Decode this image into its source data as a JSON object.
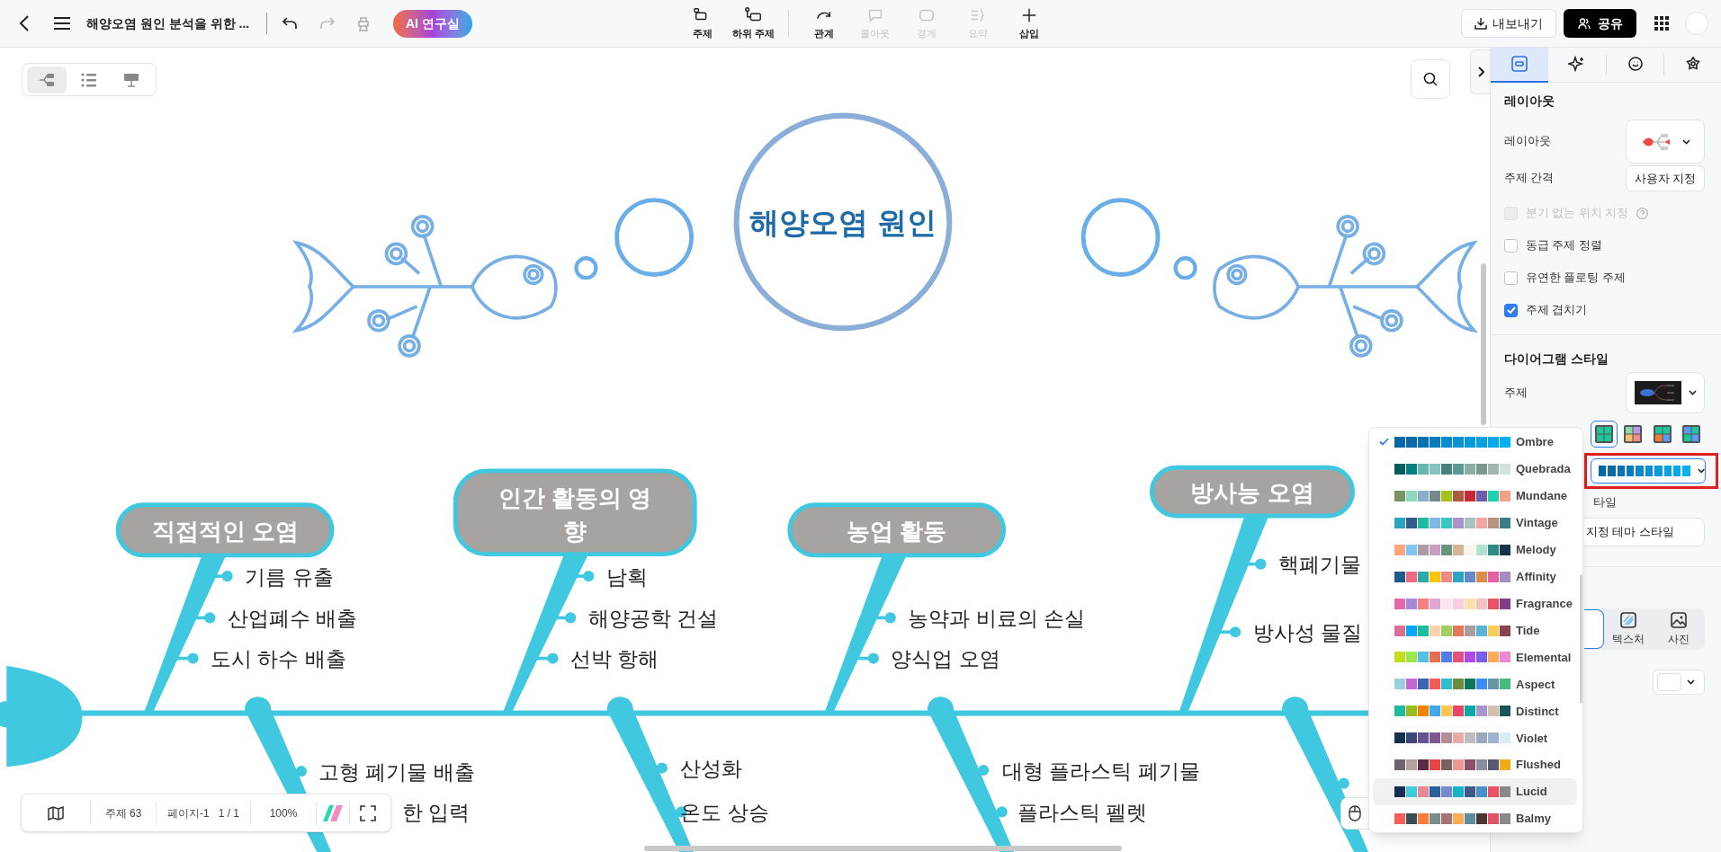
{
  "toolbar": {
    "title": "해양오염 원인 분석을 위한 ...",
    "ai_button": "AI 연구실",
    "tools": [
      {
        "label": "주제",
        "kind": "topic",
        "disabled": false
      },
      {
        "label": "하위 주제",
        "kind": "subtopic",
        "disabled": false
      },
      {
        "label": "관계",
        "kind": "relation",
        "disabled": false
      },
      {
        "label": "콜아웃",
        "kind": "callout",
        "disabled": true
      },
      {
        "label": "경계",
        "kind": "boundary",
        "disabled": true
      },
      {
        "label": "요약",
        "kind": "summary",
        "disabled": true
      },
      {
        "label": "삽입",
        "kind": "insert",
        "disabled": false
      }
    ],
    "export_button": "내보내기",
    "share_button": "공유"
  },
  "view_modes": [
    {
      "kind": "mindmap",
      "selected": true
    },
    {
      "kind": "outline",
      "selected": false
    },
    {
      "kind": "slides",
      "selected": false
    }
  ],
  "diagram": {
    "central_topic": "해양오염 원인",
    "categories": [
      {
        "label": "직접적인 오염",
        "causes": [
          "기름 유출",
          "산업폐수 배출",
          "도시 하수 배출"
        ]
      },
      {
        "label": "인간 활동의 영향",
        "causes": [
          "남획",
          "해양공학 건설",
          "선박 항해"
        ]
      },
      {
        "label": "농업 활동",
        "causes": [
          "농약과 비료의 손실",
          "양식업 오염"
        ]
      },
      {
        "label": "방사능 오염",
        "causes": [
          "핵폐기물",
          "방사성 물질"
        ]
      }
    ],
    "lower_branches": [
      {
        "kind": "branch",
        "causes": [
          "고형 폐기물 배출",
          "한 입력"
        ]
      },
      {
        "kind": "branch",
        "causes": [
          "산성화",
          "온도 상승"
        ]
      },
      {
        "kind": "branch",
        "causes": [
          "대형 플라스틱 폐기물",
          "플라스틱 펠렛"
        ]
      },
      {
        "kind": "stub"
      }
    ]
  },
  "status_bar": {
    "topics": "주제 63",
    "page": "페이지-1",
    "page_count": "1 / 1",
    "zoom": "100%"
  },
  "panel": {
    "tabs": [
      {
        "kind": "layout",
        "selected": true
      },
      {
        "kind": "ai",
        "selected": false
      },
      {
        "kind": "marker",
        "selected": false
      },
      {
        "kind": "style",
        "selected": false
      }
    ],
    "layout": {
      "title": "레이아웃",
      "layout_label": "레이아웃",
      "spacing_label": "주제 간격",
      "spacing_button": "사용자 지정",
      "options": [
        {
          "label": "분기 없는 위치 지정",
          "checked": false,
          "disabled": true,
          "help": true
        },
        {
          "label": "동급 주제 정렬",
          "checked": false,
          "disabled": false
        },
        {
          "label": "유연한 플로팅 주제",
          "checked": false,
          "disabled": false
        },
        {
          "label": "주제 겹치기",
          "checked": true,
          "disabled": false
        }
      ]
    },
    "diagram_style": {
      "title": "다이어그램 스타일",
      "theme_label": "주제",
      "color_schemes": [
        {
          "kind": "green",
          "selected": true
        },
        {
          "kind": "rainbow",
          "selected": false
        },
        {
          "kind": "orange",
          "selected": false
        },
        {
          "kind": "blue",
          "selected": false
        }
      ],
      "style_label": "타일",
      "custom_button": "지정 테마 스타일"
    },
    "background": {
      "segments": [
        {
          "kind": "color",
          "selected": true
        },
        {
          "kind": "texture",
          "label": "텍스처",
          "selected": false
        },
        {
          "kind": "photo",
          "label": "사진",
          "selected": false
        }
      ]
    }
  },
  "palette_menu": {
    "items": [
      {
        "label": "Ombre",
        "selected": true,
        "hovered": false,
        "swatches": [
          {
            "color": "#0568a6"
          },
          {
            "color": "#0a6aa8"
          },
          {
            "color": "#0b72b2"
          },
          {
            "color": "#0a7bbf"
          },
          {
            "color": "#088acf"
          },
          {
            "color": "#0793d6"
          },
          {
            "color": "#079bdc"
          },
          {
            "color": "#05a1e0"
          },
          {
            "color": "#04aae8"
          },
          {
            "color": "#03b0f0"
          }
        ]
      },
      {
        "label": "Quebrada",
        "selected": false,
        "hovered": false,
        "swatches": [
          {
            "color": "#005d5d"
          },
          {
            "color": "#008080"
          },
          {
            "color": "#6ab7b0"
          },
          {
            "color": "#88c3c3"
          },
          {
            "color": "#4a8078"
          },
          {
            "color": "#5a9a92"
          },
          {
            "color": "#8ab0a4"
          },
          {
            "color": "#7a9a8c"
          },
          {
            "color": "#a4b4ae"
          },
          {
            "color": "#d0e2dc"
          }
        ]
      },
      {
        "label": "Mundane",
        "selected": false,
        "hovered": false,
        "swatches": [
          {
            "color": "#7a9460"
          },
          {
            "color": "#8cdabb"
          },
          {
            "color": "#8ab0c8"
          },
          {
            "color": "#778890"
          },
          {
            "color": "#a4c41a"
          },
          {
            "color": "#b05a44"
          },
          {
            "color": "#c62a32"
          },
          {
            "color": "#6c5eac"
          },
          {
            "color": "#20d0a8"
          },
          {
            "color": "#f2a284"
          }
        ]
      },
      {
        "label": "Vintage",
        "selected": false,
        "hovered": false,
        "swatches": [
          {
            "color": "#2aa4c0"
          },
          {
            "color": "#345c8c"
          },
          {
            "color": "#1cbca0"
          },
          {
            "color": "#80b8e4"
          },
          {
            "color": "#38c4c4"
          },
          {
            "color": "#a894cc"
          },
          {
            "color": "#a4c4bc"
          },
          {
            "color": "#f4a4a4"
          },
          {
            "color": "#b8947c"
          },
          {
            "color": "#3a7c84"
          }
        ]
      },
      {
        "label": "Melody",
        "selected": false,
        "hovered": false,
        "swatches": [
          {
            "color": "#ffa47c"
          },
          {
            "color": "#7ec4f4"
          },
          {
            "color": "#ac9ca4"
          },
          {
            "color": "#cc9cc0"
          },
          {
            "color": "#66947c"
          },
          {
            "color": "#d4b498"
          },
          {
            "color": "#faf4ec"
          },
          {
            "color": "#b0e4d0"
          },
          {
            "color": "#2e8a88"
          },
          {
            "color": "#14364a"
          }
        ]
      },
      {
        "label": "Affinity",
        "selected": false,
        "hovered": false,
        "swatches": [
          {
            "color": "#1e5c88"
          },
          {
            "color": "#f46884"
          },
          {
            "color": "#2ea8a8"
          },
          {
            "color": "#ffc400"
          },
          {
            "color": "#ee8a84"
          },
          {
            "color": "#2ca4c4"
          },
          {
            "color": "#6688c4"
          },
          {
            "color": "#dc8c4c"
          },
          {
            "color": "#e460a0"
          },
          {
            "color": "#a48cc4"
          }
        ]
      },
      {
        "label": "Fragrance",
        "selected": false,
        "hovered": false,
        "swatches": [
          {
            "color": "#e468ac"
          },
          {
            "color": "#a888dc"
          },
          {
            "color": "#f48080"
          },
          {
            "color": "#e0a8d0"
          },
          {
            "color": "#fde4ee"
          },
          {
            "color": "#fccce0"
          },
          {
            "color": "#fde0b0"
          },
          {
            "color": "#f4c0c0"
          },
          {
            "color": "#e85464"
          },
          {
            "color": "#843c84"
          }
        ]
      },
      {
        "label": "Tide",
        "selected": false,
        "hovered": false,
        "swatches": [
          {
            "color": "#dc7094"
          },
          {
            "color": "#04a8f4"
          },
          {
            "color": "#1cbca0"
          },
          {
            "color": "#fdd4a8"
          },
          {
            "color": "#a4cc60"
          },
          {
            "color": "#e47858"
          },
          {
            "color": "#ac9ca0"
          },
          {
            "color": "#58b4d4"
          },
          {
            "color": "#fccc58"
          },
          {
            "color": "#88444c"
          }
        ]
      },
      {
        "label": "Elemental",
        "selected": false,
        "hovered": false,
        "swatches": [
          {
            "color": "#c0e01c"
          },
          {
            "color": "#9ae84c"
          },
          {
            "color": "#54c0e4"
          },
          {
            "color": "#e47050"
          },
          {
            "color": "#4c80e4"
          },
          {
            "color": "#e45084"
          },
          {
            "color": "#b04ce4"
          },
          {
            "color": "#7c5cec"
          },
          {
            "color": "#fcac58"
          },
          {
            "color": "#ec88d4"
          }
        ]
      },
      {
        "label": "Aspect",
        "selected": false,
        "hovered": false,
        "swatches": [
          {
            "color": "#98d0e0"
          },
          {
            "color": "#c864d4"
          },
          {
            "color": "#3c64b0"
          },
          {
            "color": "#f45a5a"
          },
          {
            "color": "#30bcd0"
          },
          {
            "color": "#6c8c3c"
          },
          {
            "color": "#0c7858"
          },
          {
            "color": "#3c8cfc"
          },
          {
            "color": "#6894a8"
          },
          {
            "color": "#44bc7c"
          }
        ]
      },
      {
        "label": "Distinct",
        "selected": false,
        "hovered": false,
        "swatches": [
          {
            "color": "#1cbc9c"
          },
          {
            "color": "#9cbc20"
          },
          {
            "color": "#f08400"
          },
          {
            "color": "#40a8ec"
          },
          {
            "color": "#fcc850"
          },
          {
            "color": "#e84464"
          },
          {
            "color": "#04aca4"
          },
          {
            "color": "#ac94d0"
          },
          {
            "color": "#d4c0ac"
          },
          {
            "color": "#1c545c"
          }
        ]
      },
      {
        "label": "Violet",
        "selected": false,
        "hovered": false,
        "swatches": [
          {
            "color": "#14304c"
          },
          {
            "color": "#3c4878"
          },
          {
            "color": "#645494"
          },
          {
            "color": "#7c5894"
          },
          {
            "color": "#b48c94"
          },
          {
            "color": "#e8aca4"
          },
          {
            "color": "#c0bcc4"
          },
          {
            "color": "#9ca8bc"
          },
          {
            "color": "#9cb4d0"
          },
          {
            "color": "#d8ecf4"
          }
        ]
      },
      {
        "label": "Flushed",
        "selected": false,
        "hovered": false,
        "swatches": [
          {
            "color": "#70646c"
          },
          {
            "color": "#b4a09c"
          },
          {
            "color": "#5c2c44"
          },
          {
            "color": "#e84444"
          },
          {
            "color": "#7c6060"
          },
          {
            "color": "#f09494"
          },
          {
            "color": "#8c5068"
          },
          {
            "color": "#8c8ca0"
          },
          {
            "color": "#585870"
          },
          {
            "color": "#f0ac10"
          }
        ]
      },
      {
        "label": "Lucid",
        "selected": false,
        "hovered": true,
        "swatches": [
          {
            "color": "#142c54"
          },
          {
            "color": "#3cccdc"
          },
          {
            "color": "#e88894"
          },
          {
            "color": "#28609c"
          },
          {
            "color": "#7888d0"
          },
          {
            "color": "#14b4c8"
          },
          {
            "color": "#40588c"
          },
          {
            "color": "#4890c8"
          },
          {
            "color": "#ec5064"
          },
          {
            "color": "#8c8888"
          }
        ]
      },
      {
        "label": "Balmy",
        "selected": false,
        "hovered": false,
        "swatches": [
          {
            "color": "#f46058"
          },
          {
            "color": "#3c4c54"
          },
          {
            "color": "#fc7c3c"
          },
          {
            "color": "#7a8c88"
          },
          {
            "color": "#a47474"
          },
          {
            "color": "#fcac54"
          },
          {
            "color": "#5c8ca0"
          },
          {
            "color": "#4c3434"
          },
          {
            "color": "#e05464"
          },
          {
            "color": "#888888"
          }
        ]
      }
    ]
  }
}
